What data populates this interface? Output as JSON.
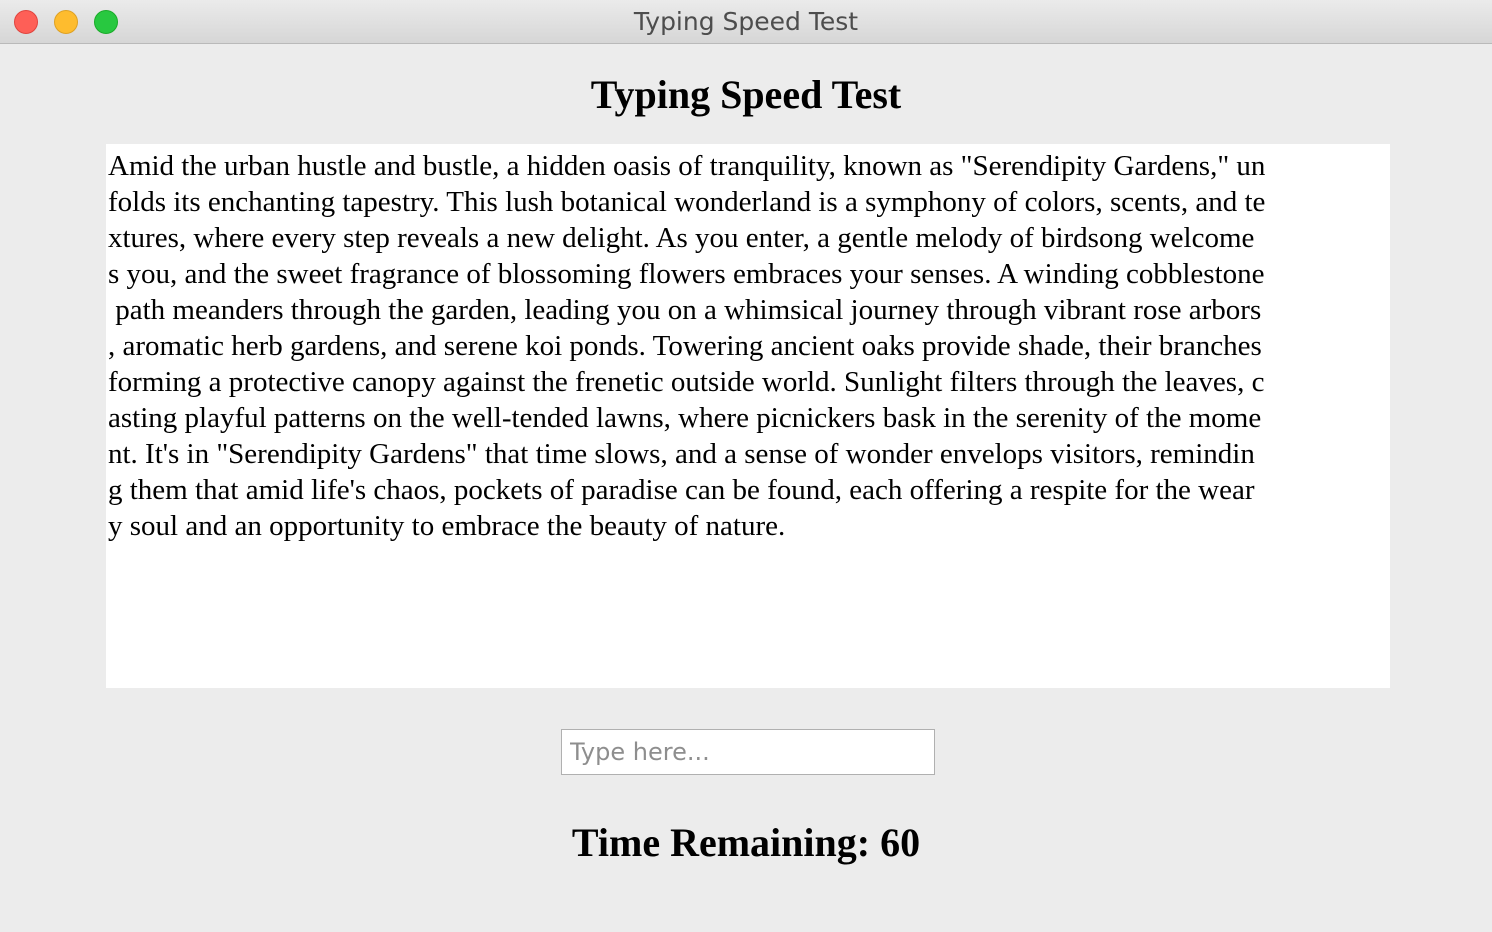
{
  "window": {
    "title": "Typing Speed Test"
  },
  "heading": "Typing Speed Test",
  "passage": {
    "lines": [
      "Amid the urban hustle and bustle, a hidden oasis of tranquility, known as \"Serendipity Gardens,\" un",
      "folds its enchanting tapestry. This lush botanical wonderland is a symphony of colors, scents, and te",
      "xtures, where every step reveals a new delight. As you enter, a gentle melody of birdsong welcome",
      "s you, and the sweet fragrance of blossoming flowers embraces your senses. A winding cobblestone",
      " path meanders through the garden, leading you on a whimsical journey through vibrant rose arbors",
      ", aromatic herb gardens, and serene koi ponds. Towering ancient oaks provide shade, their branches",
      "forming a protective canopy against the frenetic outside world. Sunlight filters through the leaves, c",
      "asting playful patterns on the well-tended lawns, where picnickers bask in the serenity of the mome",
      "nt. It's in \"Serendipity Gardens\" that time slows, and a sense of wonder envelops visitors, remindin",
      "g them that amid life's chaos, pockets of paradise can be found, each offering a respite for the wear",
      "y soul and an opportunity to embrace the beauty of nature."
    ]
  },
  "input": {
    "value": "",
    "placeholder": "Type here..."
  },
  "timer": {
    "text": "Time Remaining: 60"
  },
  "colors": {
    "window_background": "#ececec",
    "text_area_background": "#ffffff",
    "close_button": "#fe5f57",
    "minimize_button": "#febc2e",
    "zoom_button": "#28c840"
  }
}
